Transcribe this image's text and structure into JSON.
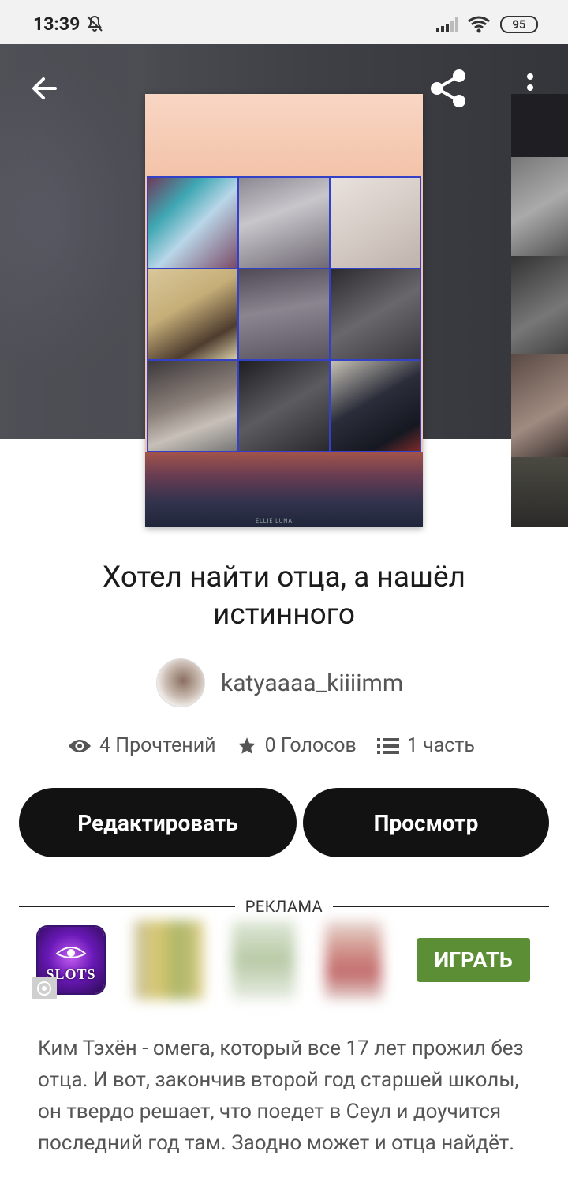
{
  "status_bar": {
    "time": "13:39",
    "battery": "95"
  },
  "book": {
    "title": "Хотел найти отца, а нашёл истинного",
    "author": "katyaaaa_kiiiimm",
    "reads": "4 Прочтений",
    "votes": "0 Голосов",
    "parts": "1 часть",
    "cover_signature": "ELLIE LUNA",
    "description": "Ким Тэхён - омега, который все 17 лет прожил без отца. И вот, закончив второй год старшей школы, он твердо решает, что поедет в Сеул и доучится последний год там. Заодно может и отца найдёт."
  },
  "buttons": {
    "edit": "Редактировать",
    "view": "Просмотр"
  },
  "ad": {
    "label": "РЕКЛАМА",
    "app_icon_text": "SLOTS",
    "play": "ИГРАТЬ"
  },
  "icons": [
    "back-arrow-icon",
    "share-icon",
    "more-vert-icon",
    "eye-icon",
    "star-icon",
    "list-icon",
    "mute-bell-icon",
    "signal-icon",
    "wifi-icon"
  ],
  "colors": {
    "button_bg": "#121212",
    "play_green": "#5c8f35",
    "grid_border": "#3340c8"
  }
}
